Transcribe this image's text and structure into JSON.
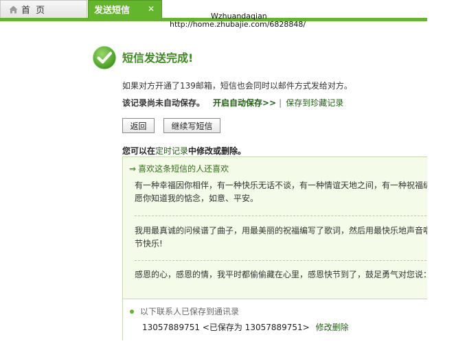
{
  "tabs": {
    "home_label": "首 页",
    "active_label": "发送短信",
    "close_glyph": "✕"
  },
  "watermark": {
    "line1": "Wzhuandaqian",
    "line2": "http://home.zhubajie.com/6828848/"
  },
  "result": {
    "title": "短信发送完成!",
    "info": "如果对方开通了139邮箱，短信也会同时以邮件方式发给对方。",
    "autosave_note": "该记录尚未自动保存。",
    "autosave_link": "开启自动保存>>",
    "separator": "|",
    "favorite_link": "保存到珍藏记录"
  },
  "buttons": {
    "back": "返回",
    "continue": "继续写短信"
  },
  "edit_note": {
    "prefix": "您可以在",
    "link": "定时记录",
    "suffix": "中修改或删除。"
  },
  "recommend": {
    "arrow": "⇒",
    "heading": "喜欢这条短信的人还喜欢",
    "items": [
      {
        "line1": "有一种幸福因你相伴，有一种快乐无话不谈，有一种情谊天地之间，有一种祝福纵有",
        "line2": "愿你知道我的惦念，如意、平安。"
      },
      {
        "line1": "我用最真诚的问候谱了曲子，用最美丽的祝福编写了歌词，然后用最快乐地声音唱出",
        "line2": "节快乐!"
      },
      {
        "line1": "感恩的心，感恩的情，我平时都偷偷藏在心里，感恩快节到了，鼓足勇气对您说：谢"
      }
    ]
  },
  "contacts": {
    "heading": "以下联系人已保存到通讯录",
    "number": "13057889751",
    "saved_text": "<已保存为 13057889751>",
    "edit_link": "修改删除"
  },
  "colors": {
    "brand_green": "#63b52b",
    "link_green": "#1f5e0f",
    "panel_bg": "#f4fbe8"
  }
}
